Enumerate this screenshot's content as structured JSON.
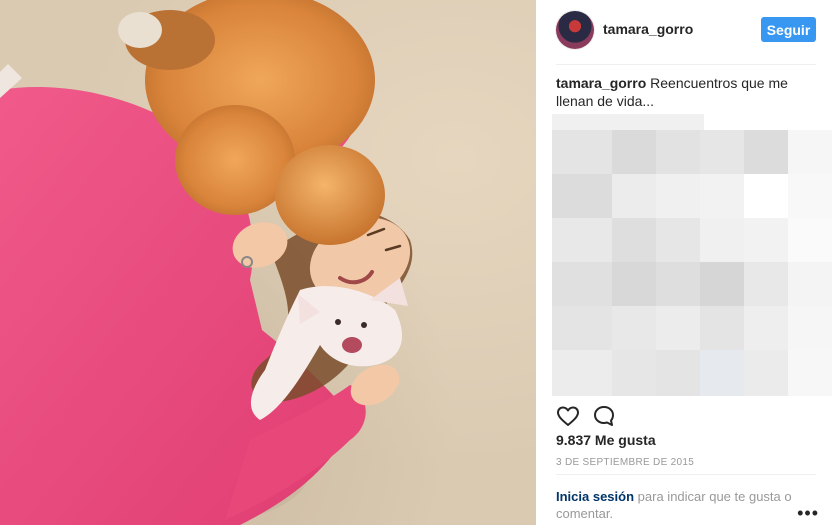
{
  "post": {
    "photo_alt_icon": "photo-image",
    "author": {
      "username": "tamara_gorro",
      "avatar_icon": "avatar-image"
    },
    "follow_label": "Seguir",
    "caption": {
      "username": "tamara_gorro",
      "text": "Reencuentros que me llenan de vida..."
    },
    "likes_text": "9.837 Me gusta",
    "date_text": "3 DE SEPTIEMBRE DE 2015",
    "login_prompt": {
      "link_text": "Inicia sesión",
      "rest_text": "para indicar que te gusta o comentar."
    },
    "more_icon": "more-options-icon",
    "icons": {
      "like": "heart-icon",
      "comment": "comment-icon"
    }
  },
  "colors": {
    "accent": "#3897f0",
    "link": "#003569",
    "muted": "#999999",
    "sweater": "#e8477a",
    "pomeranian": "#d98a3e",
    "carpet": "#dacab2"
  }
}
